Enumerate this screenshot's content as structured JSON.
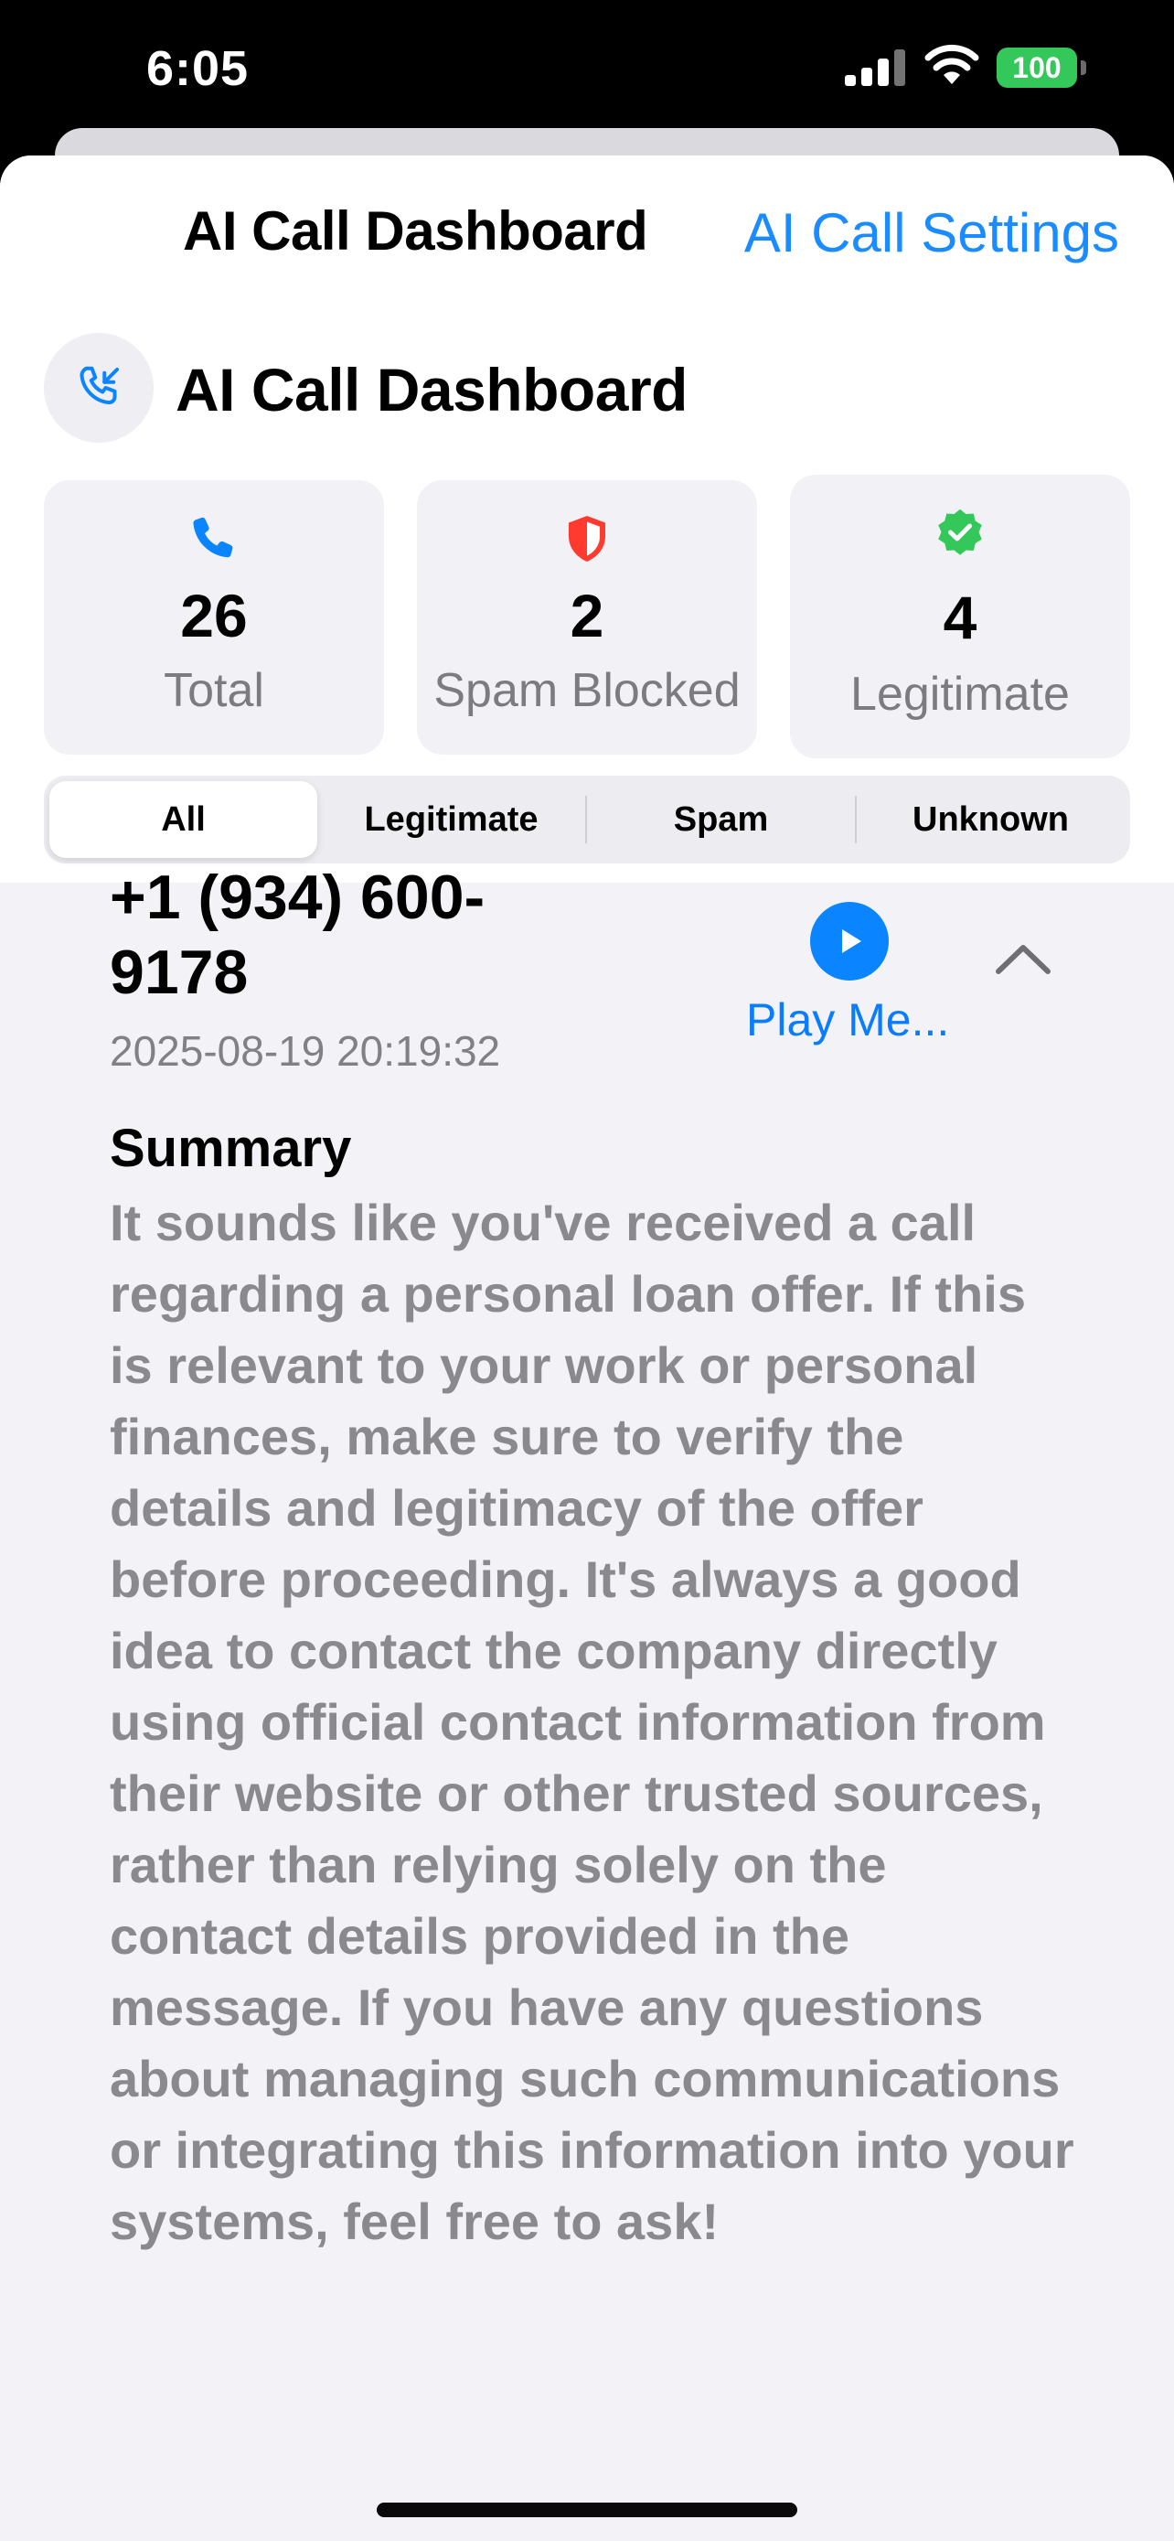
{
  "status_bar": {
    "time": "6:05",
    "battery": "100",
    "icons": [
      "signal-icon",
      "wifi-icon",
      "battery-icon"
    ]
  },
  "nav": {
    "title": "AI Call Dashboard",
    "action_label": "AI Call Settings"
  },
  "header": {
    "title": "AI Call Dashboard",
    "icon": "incoming-call-icon"
  },
  "stats": {
    "total": {
      "value": "26",
      "label": "Total",
      "icon": "phone-icon"
    },
    "spam": {
      "value": "2",
      "label": "Spam Blocked",
      "icon": "shield-icon"
    },
    "legitimate": {
      "value": "4",
      "label": "Legitimate",
      "icon": "verified-badge-icon"
    }
  },
  "filters": {
    "options": [
      "All",
      "Legitimate",
      "Spam",
      "Unknown"
    ],
    "selected": "All"
  },
  "call": {
    "number": "+1 (934) 600-9178",
    "timestamp": "2025-08-19 20:19:32",
    "play_label": "Play Me...",
    "summary_title": "Summary",
    "summary_text": "It sounds like you've received a call regarding a personal loan offer. If this is relevant to your work or personal finances, make sure to verify the details and legitimacy of the offer before proceeding. It's always a good idea to contact the company directly using official contact information from their website or other trusted sources, rather than relying solely on the contact details provided in the message. If you have any questions about managing such communications or integrating this information into your systems, feel free to ask!"
  },
  "colors": {
    "accent": "#0a84ff",
    "spam": "#ff3b30",
    "legit": "#34c759",
    "background": "#f2f2f7"
  }
}
